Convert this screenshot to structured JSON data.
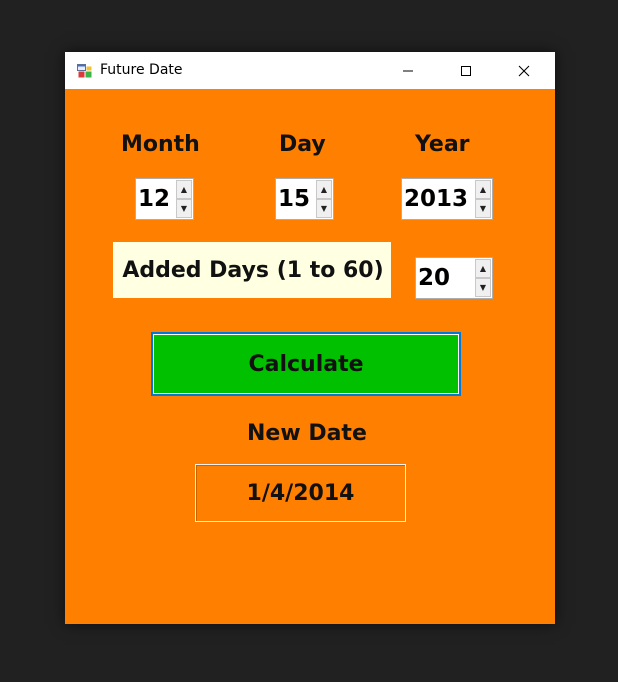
{
  "window": {
    "title": "Future Date"
  },
  "labels": {
    "month": "Month",
    "day": "Day",
    "year": "Year",
    "added_days": "Added Days (1 to 60)",
    "new_date": "New Date"
  },
  "inputs": {
    "month": "12",
    "day": "15",
    "year": "2013",
    "added_days": "20"
  },
  "buttons": {
    "calculate": "Calculate"
  },
  "result": {
    "value": "1/4/2014"
  },
  "colors": {
    "form_background": "#ff7f00",
    "calculate_button": "#00c000",
    "label_background": "#ffffe1",
    "focus_border": "#0078d7"
  }
}
